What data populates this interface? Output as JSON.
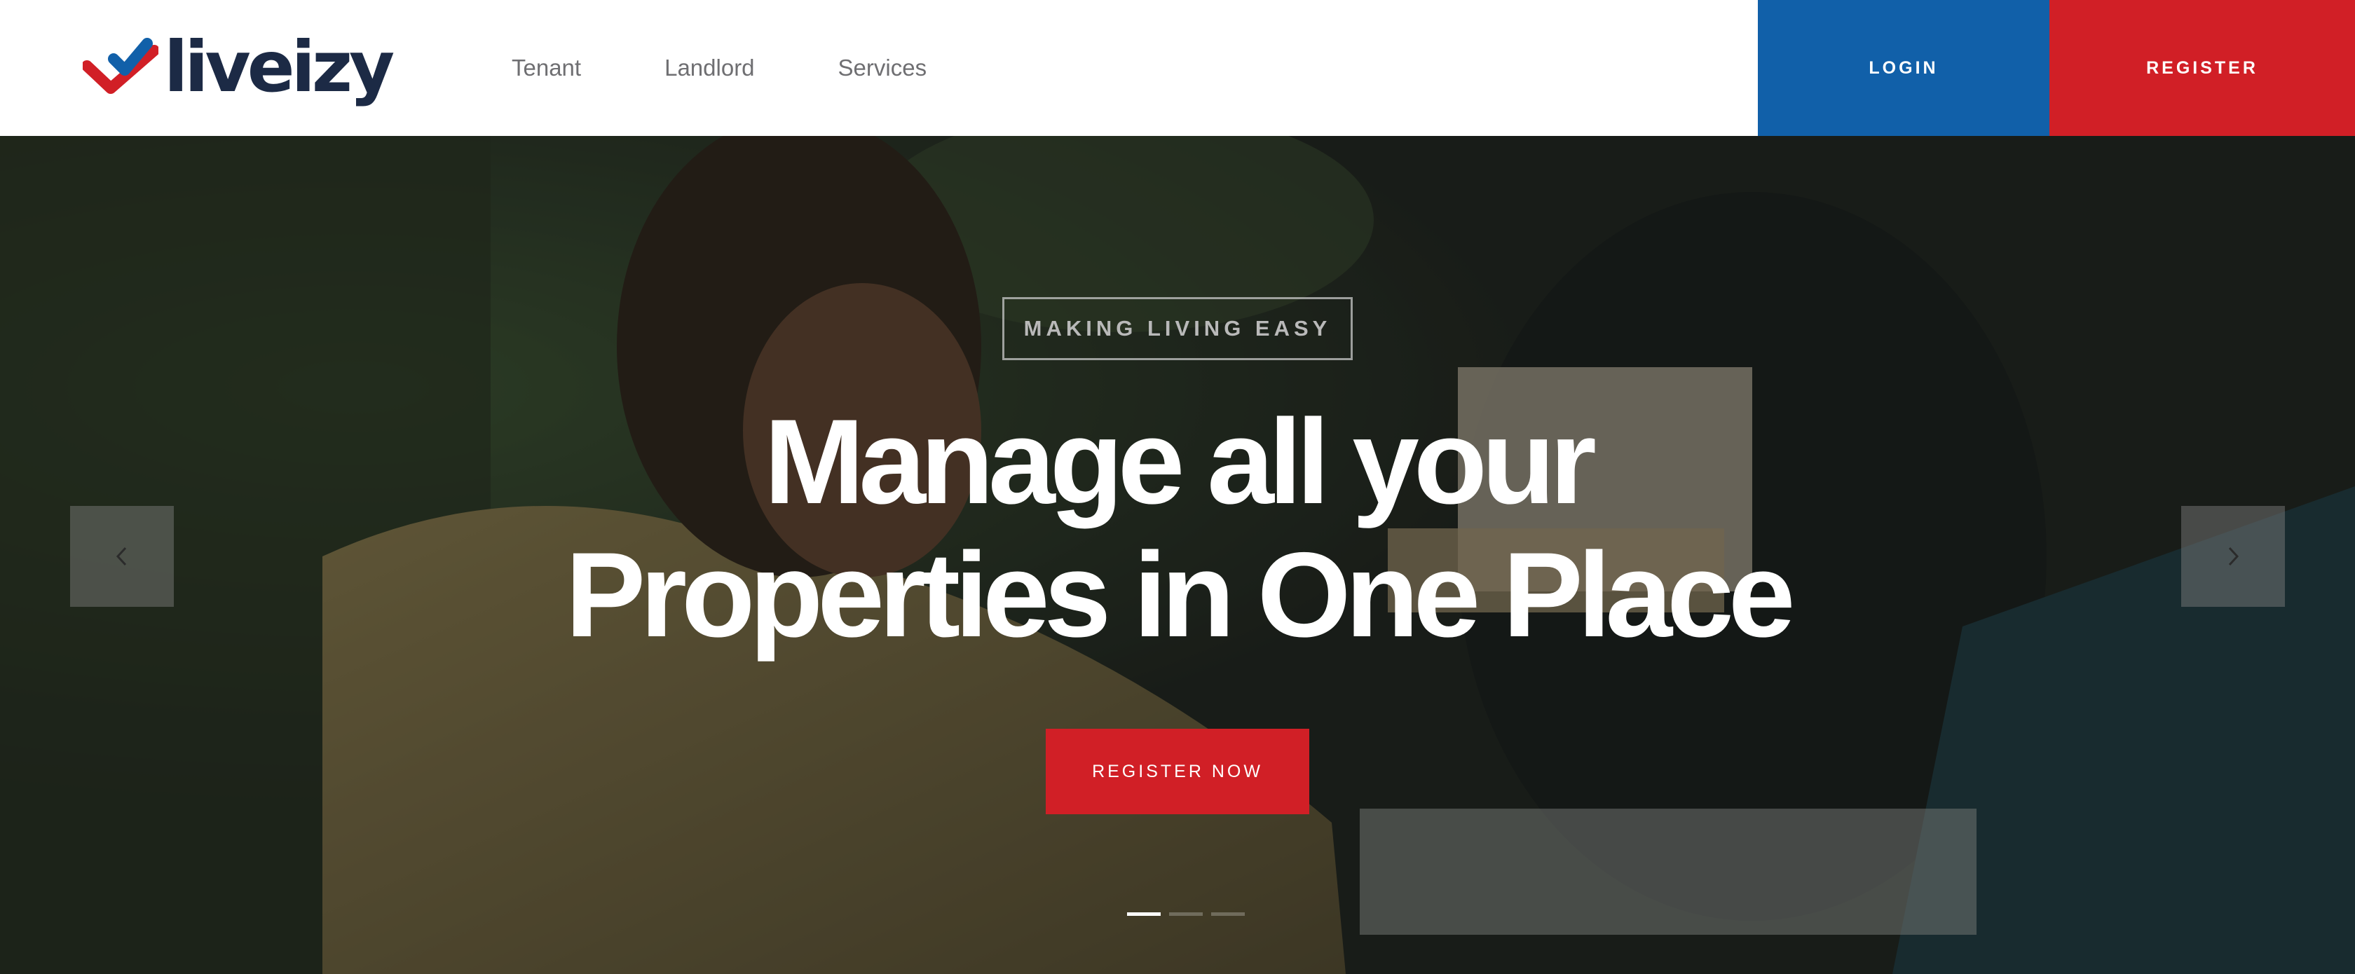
{
  "brand": {
    "name": "liveizy",
    "colors": {
      "blue": "#1160a9",
      "red": "#d11f26",
      "navy": "#1c2a45"
    }
  },
  "nav": {
    "items": [
      {
        "label": "Tenant"
      },
      {
        "label": "Landlord"
      },
      {
        "label": "Services"
      }
    ]
  },
  "auth": {
    "login_label": "LOGIN",
    "register_label": "REGISTER"
  },
  "hero": {
    "tagline": "MAKING LIVING EASY",
    "headline_line1": "Manage all your",
    "headline_line2": "Properties in One Place",
    "cta_label": "REGISTER NOW",
    "prev_icon": "chevron-left-icon",
    "next_icon": "chevron-right-icon",
    "slides": {
      "count": 3,
      "active_index": 0
    }
  }
}
